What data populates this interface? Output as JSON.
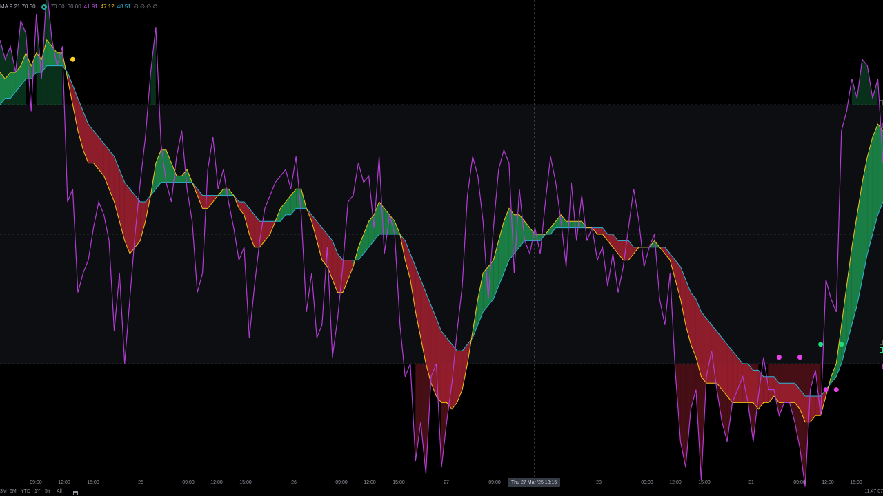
{
  "legend": {
    "name": "MA 9 21 70 30",
    "band_upper": "70.00",
    "band_lower": "30.00",
    "rsi_value": "41.91",
    "fast_value": "47.12",
    "slow_value": "48.51",
    "null_values": "∅ ∅ ∅ ∅",
    "eye_icon": "eye-icon"
  },
  "colors": {
    "background": "#000000",
    "band_fill": "#0d0e11",
    "band_line": "#3a3d45",
    "rsi": "#b23cd4",
    "fast_ma": "#f5c518",
    "slow_ma": "#29b6d9",
    "bull_fill": "#1b8a4a",
    "bear_fill": "#9b1f2e",
    "marker_yellow": "#ffd21f",
    "marker_magenta": "#e640e6",
    "marker_green": "#19e07a"
  },
  "chart_data": {
    "type": "line",
    "ylim": [
      0,
      100
    ],
    "bands": [
      70,
      50,
      30
    ],
    "x_ticks": [
      "09:00",
      "12:00",
      "15:00",
      "25",
      "09:00",
      "12:00",
      "15:00",
      "26",
      "09:00",
      "12:00",
      "15:00",
      "27",
      "09:00",
      "28",
      "09:00",
      "12:00",
      "15:00",
      "31",
      "09:00",
      "12:00",
      "15:00"
    ],
    "crosshair_label": "Thu 27 Mar '25   13:15",
    "series": [
      {
        "role": "rsi",
        "values": [
          80,
          77,
          79,
          75,
          83,
          81,
          69,
          84,
          74,
          88,
          80,
          76,
          79,
          55,
          57,
          41,
          44,
          46,
          51,
          55,
          53,
          49,
          35,
          44,
          30,
          40,
          50,
          58,
          65,
          75,
          82,
          64,
          58,
          55,
          62,
          66,
          57,
          52,
          41,
          44,
          60,
          65,
          57,
          60,
          55,
          51,
          46,
          48,
          34,
          42,
          49,
          54,
          56,
          58,
          59,
          60,
          57,
          62,
          53,
          38,
          44,
          34,
          36,
          48,
          31,
          37,
          45,
          55,
          56,
          61,
          58,
          59,
          51,
          62,
          47,
          53,
          50,
          36,
          28,
          30,
          15,
          21,
          13,
          28,
          30,
          14,
          21,
          27,
          35,
          42,
          56,
          62,
          59,
          52,
          40,
          51,
          60,
          63,
          61,
          44,
          57,
          49,
          47,
          51,
          47,
          55,
          62,
          58,
          52,
          45,
          58,
          49,
          56,
          49,
          51,
          46,
          48,
          42,
          47,
          41,
          45,
          51,
          57,
          52,
          45,
          48,
          50,
          40,
          36,
          44,
          29,
          18,
          14,
          23,
          26,
          12,
          28,
          32,
          26,
          21,
          18,
          24,
          26,
          28,
          24,
          18,
          25,
          31,
          26,
          26,
          22,
          24,
          24,
          21,
          17,
          11,
          26,
          29,
          22,
          43,
          40,
          38,
          66,
          69,
          74,
          71,
          77,
          76,
          71,
          74,
          61
        ]
      },
      {
        "role": "fast_ma",
        "values": [
          75,
          74,
          75,
          75,
          76,
          78,
          76,
          78,
          77,
          80,
          79,
          78,
          78,
          74,
          70,
          66,
          63,
          61,
          61,
          60,
          59,
          57,
          55,
          52,
          49,
          47,
          48,
          49,
          52,
          56,
          61,
          63,
          63,
          61,
          59,
          59,
          60,
          58,
          56,
          54,
          54,
          55,
          56,
          57,
          57,
          56,
          54,
          53,
          50,
          48,
          48,
          49,
          50,
          52,
          54,
          55,
          56,
          57,
          57,
          54,
          52,
          49,
          46,
          45,
          43,
          41,
          41,
          43,
          45,
          48,
          50,
          52,
          53,
          55,
          54,
          53,
          52,
          50,
          46,
          43,
          38,
          34,
          30,
          27,
          25,
          24,
          24,
          23,
          24,
          26,
          30,
          35,
          40,
          44,
          45,
          46,
          49,
          52,
          54,
          53,
          53,
          52,
          51,
          50,
          50,
          50,
          51,
          52,
          53,
          52,
          52,
          52,
          52,
          51,
          51,
          50,
          50,
          49,
          48,
          47,
          46,
          46,
          47,
          48,
          48,
          48,
          49,
          48,
          47,
          46,
          43,
          40,
          36,
          33,
          31,
          28,
          27,
          27,
          27,
          26,
          25,
          24,
          24,
          24,
          24,
          24,
          23,
          24,
          24,
          25,
          24,
          24,
          24,
          24,
          23,
          21,
          21,
          22,
          22,
          25,
          28,
          30,
          36,
          42,
          48,
          53,
          58,
          62,
          65,
          67,
          66
        ]
      },
      {
        "role": "slow_ma",
        "values": [
          70,
          71,
          71,
          72,
          73,
          74,
          74,
          75,
          75,
          76,
          76,
          76,
          76,
          75,
          73,
          71,
          69,
          67,
          66,
          65,
          64,
          63,
          62,
          60,
          58,
          57,
          56,
          55,
          55,
          56,
          57,
          58,
          58,
          58,
          58,
          58,
          58,
          58,
          57,
          56,
          56,
          56,
          56,
          56,
          56,
          56,
          55,
          55,
          54,
          53,
          52,
          52,
          52,
          52,
          52,
          53,
          53,
          54,
          54,
          54,
          53,
          52,
          51,
          50,
          49,
          47,
          46,
          46,
          46,
          46,
          47,
          48,
          49,
          50,
          50,
          50,
          50,
          50,
          49,
          47,
          45,
          43,
          41,
          39,
          37,
          35,
          34,
          33,
          32,
          32,
          33,
          34,
          36,
          38,
          39,
          40,
          42,
          44,
          46,
          47,
          48,
          49,
          49,
          49,
          49,
          50,
          50,
          51,
          51,
          51,
          51,
          51,
          51,
          51,
          51,
          51,
          51,
          50,
          50,
          49,
          49,
          49,
          48,
          48,
          48,
          48,
          48,
          48,
          48,
          47,
          46,
          45,
          43,
          41,
          40,
          38,
          37,
          36,
          35,
          34,
          33,
          32,
          31,
          30,
          30,
          29,
          29,
          28,
          28,
          28,
          27,
          27,
          27,
          27,
          26,
          25,
          25,
          25,
          25,
          26,
          27,
          28,
          30,
          33,
          36,
          39,
          43,
          47,
          50,
          53,
          55
        ]
      }
    ],
    "markers": [
      {
        "x_index": 14,
        "value": 77,
        "kind": "yellow"
      },
      {
        "x_index": 150,
        "value": 31,
        "kind": "magenta"
      },
      {
        "x_index": 154,
        "value": 31,
        "kind": "magenta"
      },
      {
        "x_index": 159,
        "value": 26,
        "kind": "magenta"
      },
      {
        "x_index": 161,
        "value": 26,
        "kind": "magenta"
      },
      {
        "x_index": 158,
        "value": 33,
        "kind": "green"
      },
      {
        "x_index": 162,
        "value": 33,
        "kind": "green"
      }
    ]
  },
  "bottom_bar": {
    "ranges": [
      "3M",
      "6M",
      "YTD",
      "1Y",
      "5Y",
      "All"
    ],
    "calendar_icon": "calendar-icon",
    "clock": "11:47:07"
  }
}
